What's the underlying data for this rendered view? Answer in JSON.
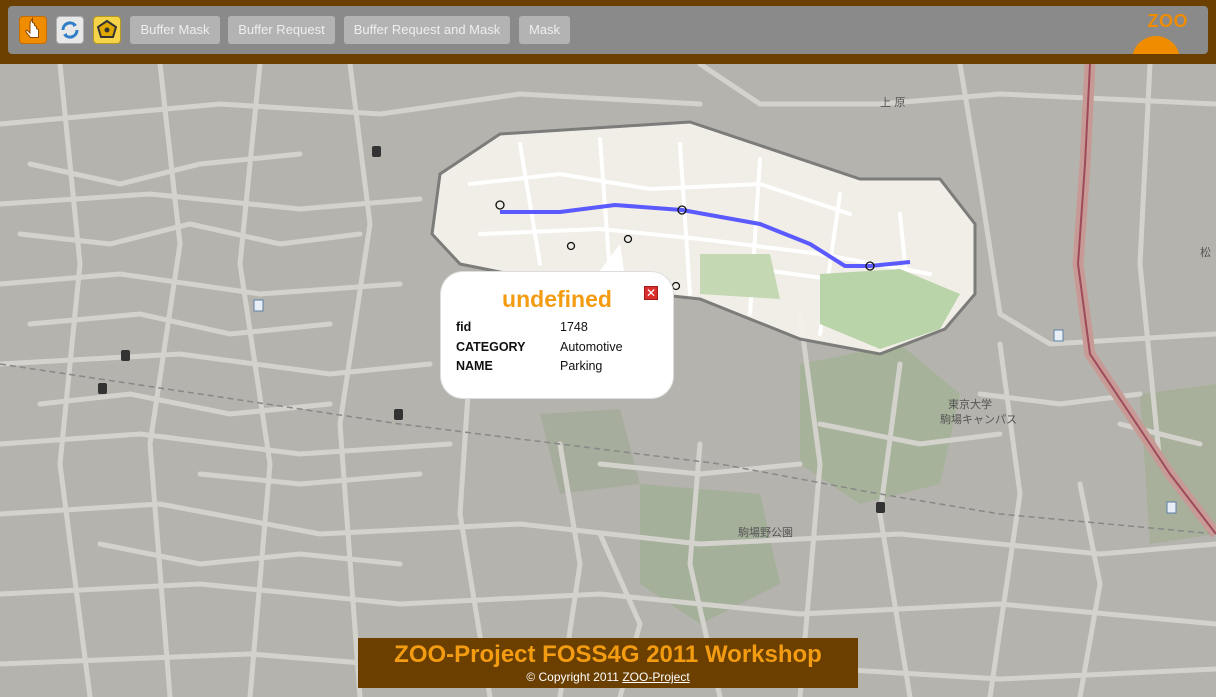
{
  "toolbar": {
    "tools": [
      {
        "name": "pan-hand-icon"
      },
      {
        "name": "refresh-icon"
      },
      {
        "name": "select-feature-icon"
      }
    ],
    "buttons": {
      "buffer_mask": "Buffer Mask",
      "buffer_request": "Buffer Request",
      "buffer_request_and_mask": "Buffer Request and Mask",
      "mask": "Mask"
    },
    "logo_text": "ZOO"
  },
  "map": {
    "labels": {
      "kamihara": "上 原",
      "matsu": "松",
      "todai": "東京大学",
      "komaba_campus": "駒場キャンパス",
      "komaba_park": "駒場野公園"
    }
  },
  "popup": {
    "title": "undefined",
    "rows": [
      {
        "key": "fid",
        "value": "1748"
      },
      {
        "key": "CATEGORY",
        "value": "Automotive"
      },
      {
        "key": "NAME",
        "value": "Parking"
      }
    ]
  },
  "footer": {
    "title": "ZOO-Project FOSS4G 2011 Workshop",
    "copyright": "© Copyright 2011",
    "link_text": "ZOO-Project"
  },
  "colors": {
    "header_brown": "#6b3f00",
    "accent_orange": "#f39c12",
    "route_blue": "#5a5aff",
    "map_gray": "#b5b3ad"
  }
}
